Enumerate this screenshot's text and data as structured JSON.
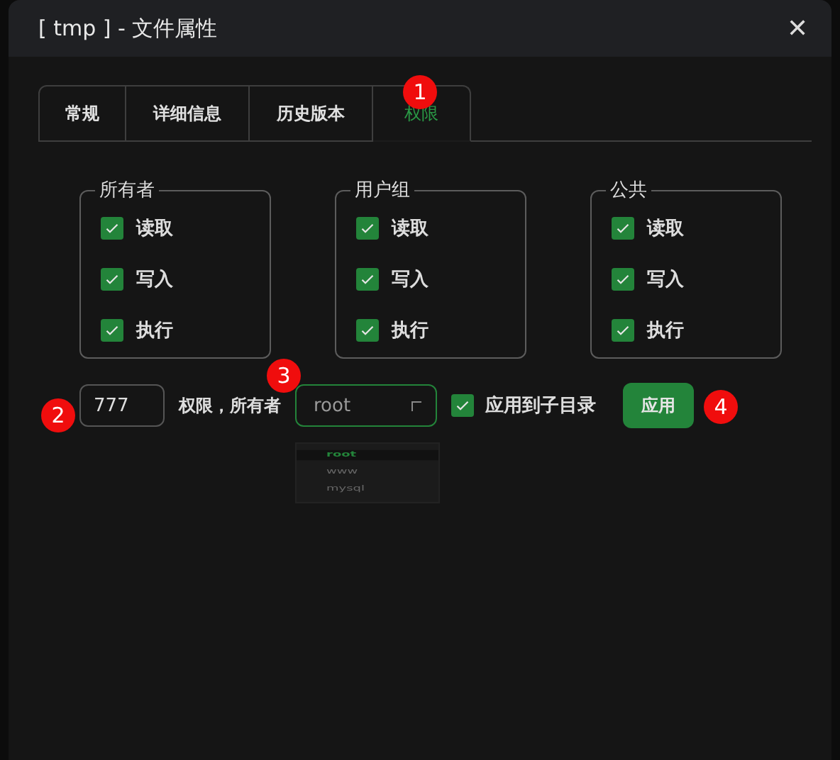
{
  "window": {
    "title": "[ tmp ] - 文件属性",
    "close": "✕"
  },
  "tabs": [
    {
      "label": "常规",
      "selected": false
    },
    {
      "label": "详细信息",
      "selected": false
    },
    {
      "label": "历史版本",
      "selected": false
    },
    {
      "label": "权限",
      "selected": true
    }
  ],
  "groups": [
    {
      "title": "所有者",
      "items": [
        {
          "label": "读取",
          "checked": true
        },
        {
          "label": "写入",
          "checked": true
        },
        {
          "label": "执行",
          "checked": true
        }
      ]
    },
    {
      "title": "用户组",
      "items": [
        {
          "label": "读取",
          "checked": true
        },
        {
          "label": "写入",
          "checked": true
        },
        {
          "label": "执行",
          "checked": true
        }
      ]
    },
    {
      "title": "公共",
      "items": [
        {
          "label": "读取",
          "checked": true
        },
        {
          "label": "写入",
          "checked": true
        },
        {
          "label": "执行",
          "checked": true
        }
      ]
    }
  ],
  "mode": {
    "value": "777"
  },
  "owner_label": "权限，所有者",
  "owner_select": {
    "value": "root",
    "options": [
      {
        "label": "root",
        "selected": true
      },
      {
        "label": "www",
        "selected": false
      },
      {
        "label": "mysql",
        "selected": false
      }
    ]
  },
  "recursive": {
    "label": "应用到子目录",
    "checked": true
  },
  "apply_button": "应用",
  "badges": [
    "1",
    "2",
    "3",
    "4"
  ]
}
